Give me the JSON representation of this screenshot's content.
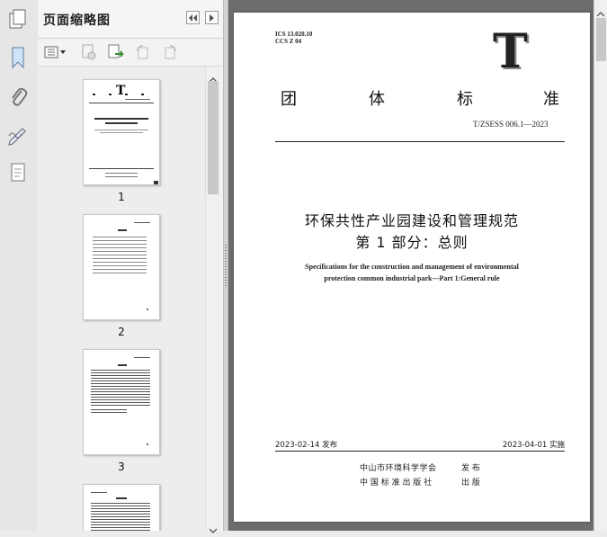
{
  "sidebar_panel": {
    "title": "页面缩略图",
    "thumbnails": [
      {
        "label": "1"
      },
      {
        "label": "2"
      },
      {
        "label": "3"
      }
    ]
  },
  "document": {
    "ics": "ICS 13.020.10",
    "ccs": "CCS Z 04",
    "logo_letter": "T",
    "standard_type": [
      "团",
      "体",
      "标",
      "准"
    ],
    "standard_number": "T/ZSESS 006.1—2023",
    "title_cn_line1": "环保共性产业园建设和管理规范",
    "title_cn_line2": "第 1 部分：总则",
    "title_en_line1": "Specifications for the construction and management of environmental",
    "title_en_line2": "protection common industrial park—Part 1:General rule",
    "issue_date": "2023-02-14 发布",
    "implement_date": "2023-04-01 实施",
    "publisher1": "中山市环境科学学会",
    "publisher1_action": "发 布",
    "publisher2": "中 国 标 准 出 版 社",
    "publisher2_action": "出 版"
  },
  "icons": {
    "rail": [
      "bookmark-icon",
      "attachment-icon",
      "signature-icon",
      "layers-icon"
    ],
    "toolbar": [
      "thumbnail-options-icon",
      "delete-page-icon",
      "insert-page-icon",
      "rotate-left-icon",
      "rotate-right-icon"
    ]
  }
}
